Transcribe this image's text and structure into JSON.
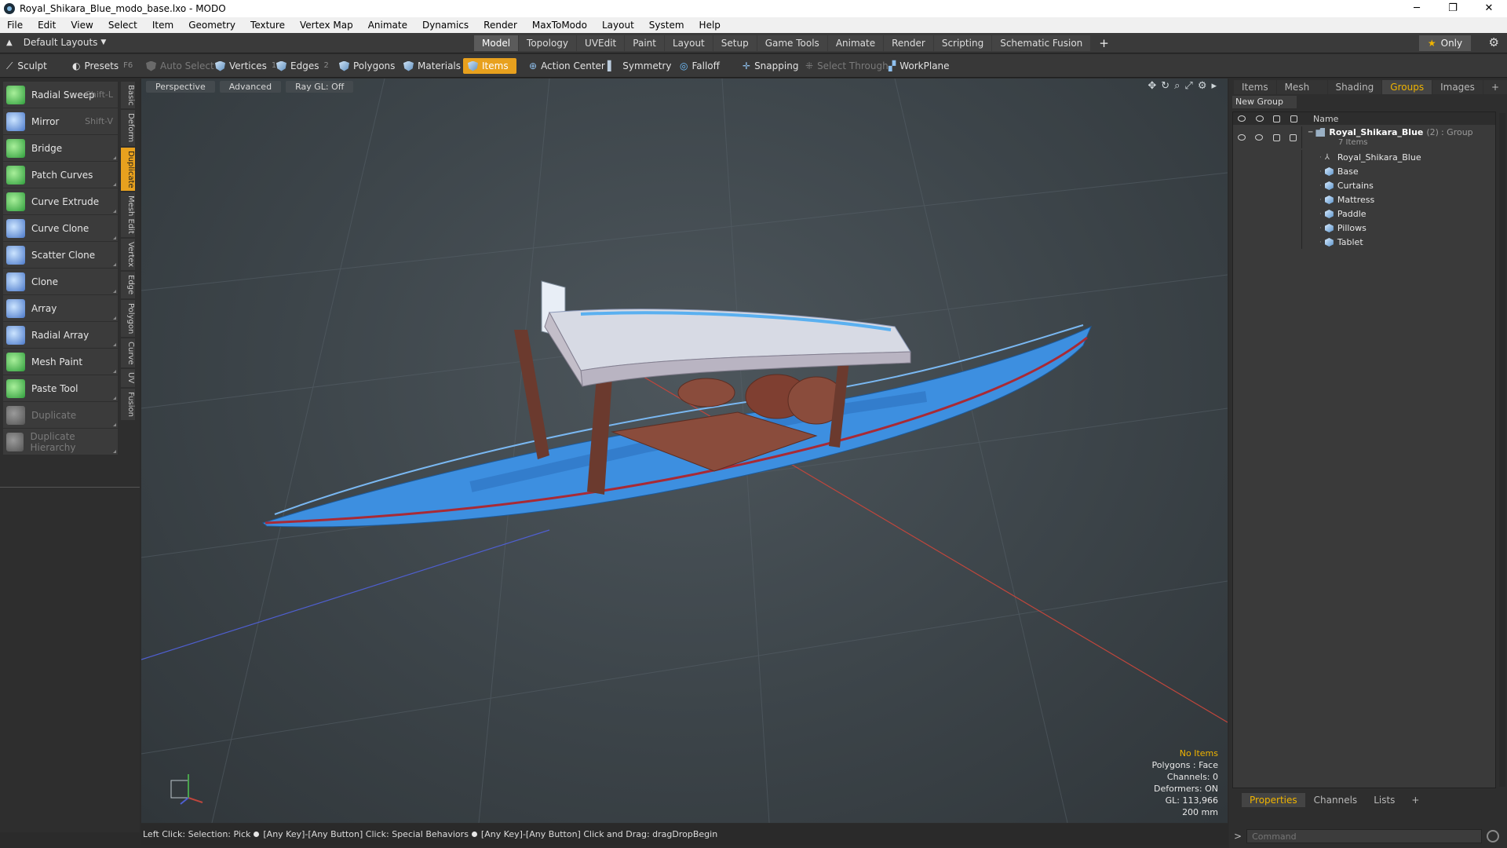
{
  "window": {
    "title": "Royal_Shikara_Blue_modo_base.lxo - MODO",
    "minimize": "─",
    "restore": "❐",
    "close": "✕"
  },
  "menu": [
    "File",
    "Edit",
    "View",
    "Select",
    "Item",
    "Geometry",
    "Texture",
    "Vertex Map",
    "Animate",
    "Dynamics",
    "Render",
    "MaxToModo",
    "Layout",
    "System",
    "Help"
  ],
  "layoutbar": {
    "layout_label": "Default Layouts",
    "tabs": [
      "Model",
      "Topology",
      "UVEdit",
      "Paint",
      "Layout",
      "Setup",
      "Game Tools",
      "Animate",
      "Render",
      "Scripting",
      "Schematic Fusion"
    ],
    "active_tab": "Model",
    "plus": "+",
    "only_label": "Only"
  },
  "toolbar": {
    "sculpt": "Sculpt",
    "presets": "Presets",
    "presets_key": "F6",
    "auto_select": "Auto Select",
    "vertices": "Vertices",
    "vertices_count": "1",
    "edges": "Edges",
    "edges_count": "2",
    "polygons": "Polygons",
    "materials": "Materials",
    "items": "Items",
    "action_center": "Action Center",
    "symmetry": "Symmetry",
    "falloff": "Falloff",
    "snapping": "Snapping",
    "select_through": "Select Through",
    "workplane": "WorkPlane"
  },
  "tools": [
    {
      "label": "Radial Sweep",
      "shortcut": "Shift-L",
      "icon": "radial-sweep-icon",
      "color": "green",
      "enabled": true
    },
    {
      "label": "Mirror",
      "shortcut": "Shift-V",
      "icon": "mirror-icon",
      "color": "blue",
      "enabled": true
    },
    {
      "label": "Bridge",
      "shortcut": "",
      "icon": "bridge-icon",
      "color": "green",
      "enabled": true
    },
    {
      "label": "Patch Curves",
      "shortcut": "",
      "icon": "patch-curves-icon",
      "color": "green",
      "enabled": true
    },
    {
      "label": "Curve Extrude",
      "shortcut": "",
      "icon": "curve-extrude-icon",
      "color": "green",
      "enabled": true
    },
    {
      "label": "Curve Clone",
      "shortcut": "",
      "icon": "curve-clone-icon",
      "color": "blue",
      "enabled": true
    },
    {
      "label": "Scatter Clone",
      "shortcut": "",
      "icon": "scatter-clone-icon",
      "color": "blue",
      "enabled": true
    },
    {
      "label": "Clone",
      "shortcut": "",
      "icon": "clone-icon",
      "color": "blue",
      "enabled": true
    },
    {
      "label": "Array",
      "shortcut": "",
      "icon": "array-icon",
      "color": "blue",
      "enabled": true
    },
    {
      "label": "Radial Array",
      "shortcut": "",
      "icon": "radial-array-icon",
      "color": "blue",
      "enabled": true
    },
    {
      "label": "Mesh Paint",
      "shortcut": "",
      "icon": "mesh-paint-icon",
      "color": "green",
      "enabled": true
    },
    {
      "label": "Paste Tool",
      "shortcut": "",
      "icon": "paste-tool-icon",
      "color": "green",
      "enabled": true
    },
    {
      "label": "Duplicate",
      "shortcut": "",
      "icon": "duplicate-icon",
      "color": "grey",
      "enabled": false
    },
    {
      "label": "Duplicate Hierarchy",
      "shortcut": "",
      "icon": "duplicate-hierarchy-icon",
      "color": "grey",
      "enabled": false
    }
  ],
  "vtabs": [
    "Basic",
    "Deform",
    "Duplicate",
    "Mesh Edit",
    "Vertex",
    "Edge",
    "Polygon",
    "Curve",
    "UV",
    "Fusion"
  ],
  "active_vtab": "Duplicate",
  "viewport": {
    "view": "Perspective",
    "mode": "Advanced",
    "raygl": "Ray GL: Off",
    "info": {
      "selection": "No Items",
      "polygons": "Polygons : Face",
      "channels": "Channels: 0",
      "deformers": "Deformers: ON",
      "gl": "GL: 113,966",
      "scale": "200 mm"
    }
  },
  "statusbar": {
    "part1": "Left Click: Selection: Pick",
    "part2": "[Any Key]-[Any Button] Click: Special Behaviors",
    "part3": "[Any Key]-[Any Button] Click and Drag: dragDropBegin"
  },
  "rightpanel": {
    "tabs": [
      "Items",
      "Mesh ...",
      "Shading",
      "Groups",
      "Images"
    ],
    "active_tab": "Groups",
    "new_group": "New Group",
    "name_header": "Name",
    "group": {
      "name": "Royal_Shikara_Blue",
      "count": "(2)",
      "type": ": Group",
      "subtitle": "7 Items"
    },
    "children": [
      {
        "name": "Royal_Shikara_Blue",
        "type": "locator"
      },
      {
        "name": "Base",
        "type": "mesh"
      },
      {
        "name": "Curtains",
        "type": "mesh"
      },
      {
        "name": "Mattress",
        "type": "mesh"
      },
      {
        "name": "Paddle",
        "type": "mesh"
      },
      {
        "name": "Pillows",
        "type": "mesh"
      },
      {
        "name": "Tablet",
        "type": "mesh"
      }
    ],
    "bottom_tabs": [
      "Properties",
      "Channels",
      "Lists"
    ],
    "active_bottom_tab": "Properties",
    "command_placeholder": "Command"
  },
  "colors": {
    "accent": "#e8a11e",
    "highlight_text": "#f0b400",
    "hull": "#3d8fe0",
    "canopy": "#c9c6d2",
    "red_axis": "#c0463c",
    "blue_axis": "#4f5fd0"
  }
}
